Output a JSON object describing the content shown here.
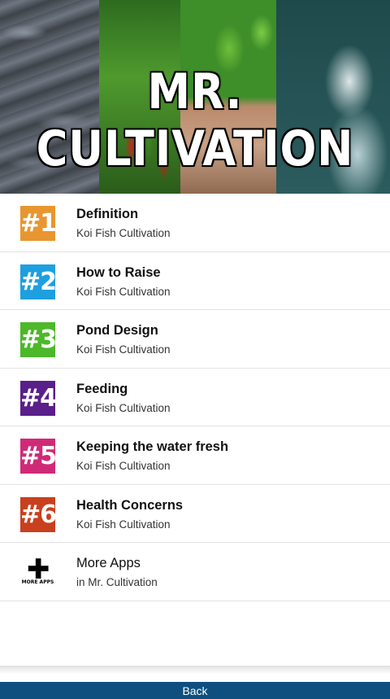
{
  "banner": {
    "title": "MR. CULTIVATION"
  },
  "items": [
    {
      "badge": "#1",
      "title": "Definition",
      "subtitle": "Koi Fish Cultivation",
      "color": "#e8962f"
    },
    {
      "badge": "#2",
      "title": "How to Raise",
      "subtitle": "Koi Fish Cultivation",
      "color": "#1e9fe0"
    },
    {
      "badge": "#3",
      "title": "Pond Design",
      "subtitle": "Koi Fish Cultivation",
      "color": "#4cb82a"
    },
    {
      "badge": "#4",
      "title": "Feeding",
      "subtitle": "Koi Fish Cultivation",
      "color": "#5a1f8a"
    },
    {
      "badge": "#5",
      "title": "Keeping the water fresh",
      "subtitle": "Koi Fish Cultivation",
      "color": "#cf2a78"
    },
    {
      "badge": "#6",
      "title": "Health Concerns",
      "subtitle": "Koi Fish Cultivation",
      "color": "#c8401e"
    }
  ],
  "more_apps": {
    "icon": "plus-icon",
    "icon_label": "MORE APPS",
    "title": "More Apps",
    "subtitle": "in Mr. Cultivation"
  },
  "footer": {
    "back_label": "Back",
    "color": "#0e4f7f"
  }
}
